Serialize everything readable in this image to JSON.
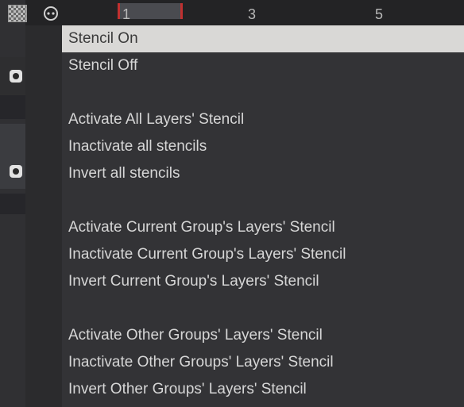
{
  "timeline": {
    "frame_numbers": [
      "1",
      "3",
      "5"
    ]
  },
  "menu": {
    "items": [
      "Stencil On",
      "Stencil Off",
      "Activate All Layers' Stencil",
      "Inactivate all stencils",
      "Invert all stencils",
      "Activate Current Group's Layers' Stencil",
      "Inactivate Current Group's Layers' Stencil",
      "Invert Current Group's Layers' Stencil",
      "Activate Other Groups' Layers' Stencil",
      "Inactivate Other Groups' Layers' Stencil",
      "Invert Other Groups' Layers' Stencil"
    ],
    "selected_index": 0
  },
  "colors": {
    "background": "#2b2b2d",
    "menu_background": "#333336",
    "menu_text": "#d6d6d6",
    "selected_background": "#d9d8d6",
    "frame_marker": "#c03030"
  }
}
